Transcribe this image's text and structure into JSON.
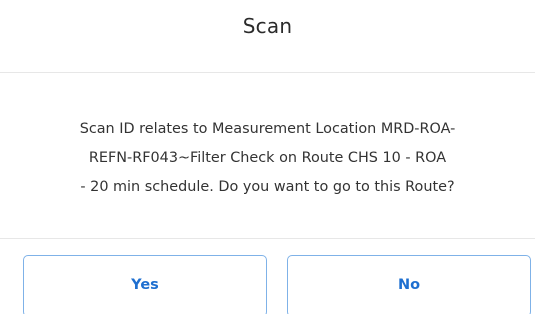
{
  "dialog": {
    "title": "Scan",
    "message_lines": [
      "Scan ID relates to Measurement Location MRD-ROA-",
      "REFN-RF043~Filter Check on Route CHS 10 - ROA",
      "- 20 min schedule. Do you want to go to this Route?"
    ],
    "yes_label": "Yes",
    "no_label": "No"
  },
  "colors": {
    "accent": "#1e6fd0",
    "button_border": "#7fb2e8",
    "divider": "#e7e7e7",
    "text": "#333333"
  }
}
